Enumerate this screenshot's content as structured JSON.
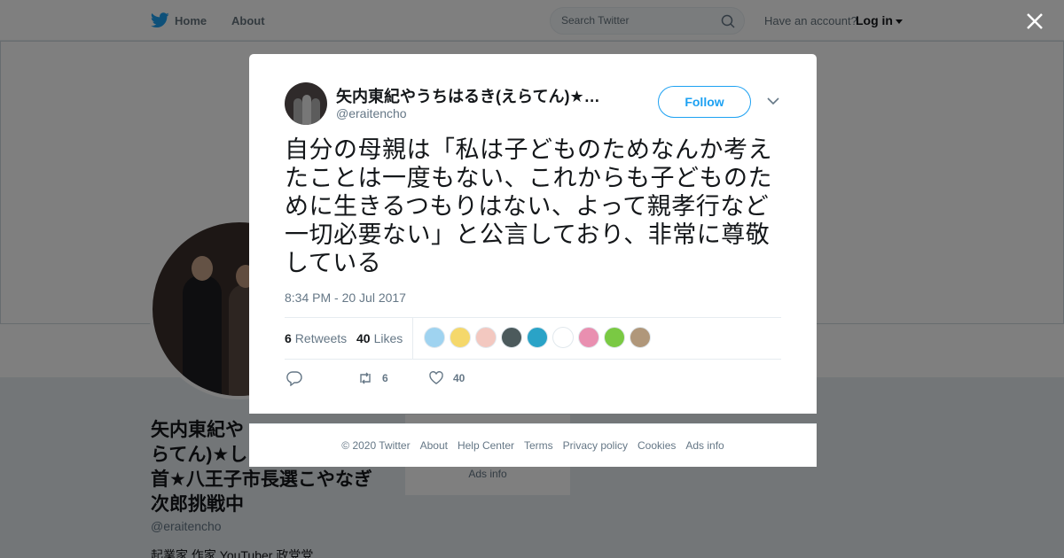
{
  "nav": {
    "home_label": "Home",
    "about_label": "About"
  },
  "search": {
    "placeholder": "Search Twitter"
  },
  "account": {
    "prompt": "Have an account?",
    "login_label": "Log in"
  },
  "profile": {
    "display_name": "矢内東紀やうちはるき(えらてん)★しばき隊の首★八王子市長選こやなぎ次郎挑戦中",
    "display_name_visible": "矢内東紀や　　　　　　　　らてん)★し　　　　　　　　首★八王子市長選こやなぎ次郎挑戦中",
    "handle": "@eraitencho",
    "bio": "起業家 作家 YouTuber 政党党"
  },
  "bg_footer": {
    "ads_info": "Ads info"
  },
  "tweet": {
    "author_name": "矢内東紀やうちはるき(えらてん)★…",
    "author_handle": "@eraitencho",
    "follow_label": "Follow",
    "text": "自分の母親は「私は子どものためなんか考えたことは一度もない、これからも子どものために生きるつもりはない、よって親孝行など一切必要ない」と公言しており、非常に尊敬している",
    "timestamp": "8:34 PM - 20 Jul 2017",
    "retweet_count": "6",
    "retweets_label": "Retweets",
    "like_count": "40",
    "likes_label": "Likes",
    "action_retweet_count": "6",
    "action_like_count": "40"
  },
  "likers": [
    {
      "color": "#9fd3f0",
      "name": "liker-1"
    },
    {
      "color": "#f5d86b",
      "name": "liker-2"
    },
    {
      "color": "#f3c8c0",
      "name": "liker-3"
    },
    {
      "color": "#4c5a5c",
      "name": "liker-4"
    },
    {
      "color": "#2aa3c7",
      "name": "liker-5"
    },
    {
      "color": "#ffffff",
      "name": "liker-6"
    },
    {
      "color": "#e98fb0",
      "name": "liker-7"
    },
    {
      "color": "#7ac943",
      "name": "liker-8"
    },
    {
      "color": "#b0977a",
      "name": "liker-9"
    }
  ],
  "footer": {
    "copyright": "© 2020 Twitter",
    "about": "About",
    "help": "Help Center",
    "terms": "Terms",
    "privacy": "Privacy policy",
    "cookies": "Cookies",
    "ads": "Ads info"
  },
  "colors": {
    "accent": "#1da1f2",
    "text_secondary": "#657786",
    "overlay": "rgba(0,0,0,0.5)"
  }
}
